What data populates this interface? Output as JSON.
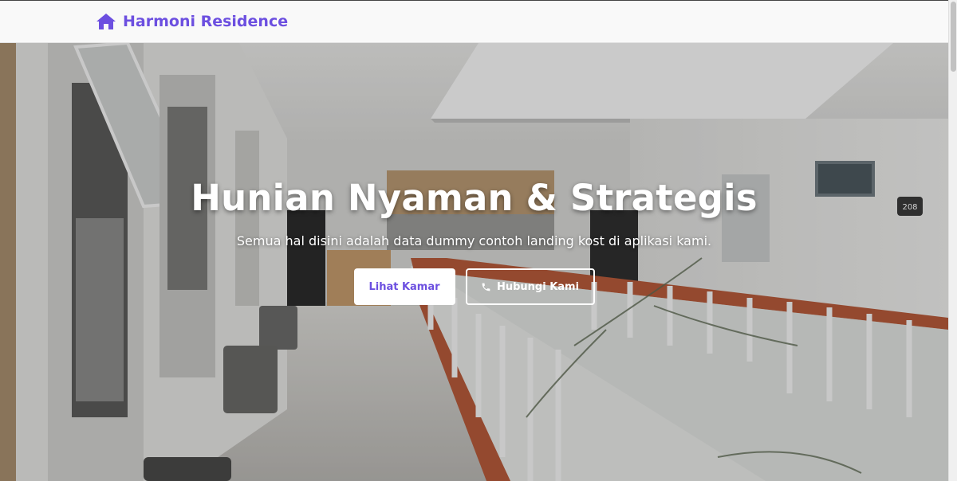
{
  "navbar": {
    "brand_name": "Harmoni Residence",
    "brand_icon": "home-icon",
    "brand_color": "#6c4fe0"
  },
  "hero": {
    "title": "Hunian Nyaman & Strategis",
    "subtitle": "Semua hal disini adalah data dummy contoh landing kost di aplikasi kami.",
    "primary_button": "Lihat Kamar",
    "secondary_button": "Hubungi Kami",
    "secondary_button_icon": "phone-icon",
    "room_number": "208"
  }
}
